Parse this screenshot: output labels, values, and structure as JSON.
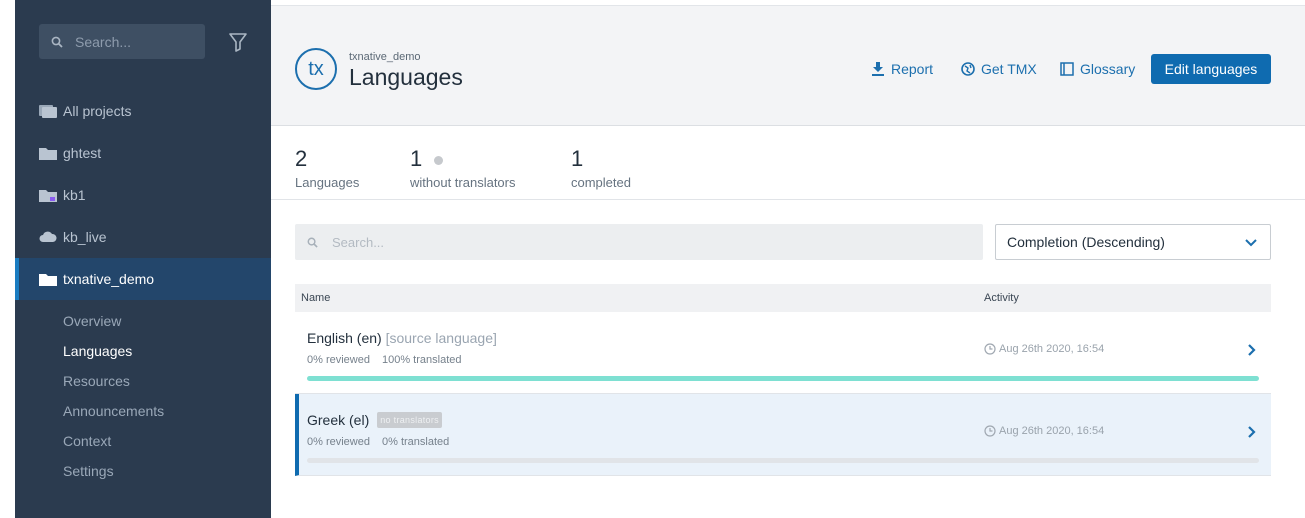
{
  "sidebar": {
    "search_placeholder": "Search...",
    "projects": [
      {
        "label": "All projects",
        "icon": "folders-icon"
      },
      {
        "label": "ghtest",
        "icon": "folder-icon"
      },
      {
        "label": "kb1",
        "icon": "folder-icon"
      },
      {
        "label": "kb_live",
        "icon": "cloud-icon"
      },
      {
        "label": "txnative_demo",
        "icon": "folder-icon",
        "active": true
      }
    ],
    "subnav": [
      {
        "label": "Overview"
      },
      {
        "label": "Languages",
        "active": true
      },
      {
        "label": "Resources"
      },
      {
        "label": "Announcements"
      },
      {
        "label": "Context"
      },
      {
        "label": "Settings"
      }
    ]
  },
  "header": {
    "logo_text": "tx",
    "breadcrumb": "txnative_demo",
    "title": "Languages",
    "actions": {
      "report": "Report",
      "get_tmx": "Get TMX",
      "glossary": "Glossary",
      "edit_languages": "Edit languages"
    }
  },
  "stats": [
    {
      "value": "2",
      "label": "Languages"
    },
    {
      "value": "1",
      "label": "without translators"
    },
    {
      "value": "1",
      "label": "completed"
    }
  ],
  "list": {
    "search_placeholder": "Search...",
    "sort_value": "Completion (Descending)",
    "columns": {
      "name": "Name",
      "activity": "Activity"
    },
    "rows": [
      {
        "name": "English (en)",
        "tag": "[source language]",
        "reviewed": "0% reviewed",
        "translated": "100% translated",
        "progress": 1.0,
        "activity": "Aug 26th 2020, 16:54"
      },
      {
        "name": "Greek (el)",
        "badge": "no translators",
        "reviewed": "0% reviewed",
        "translated": "0% translated",
        "progress": 0.0,
        "activity": "Aug 26th 2020, 16:54"
      }
    ]
  },
  "colors": {
    "sidebar_bg": "#2b3b4f",
    "accent": "#0f6bb0",
    "progress_fill": "#7ee0d2"
  }
}
